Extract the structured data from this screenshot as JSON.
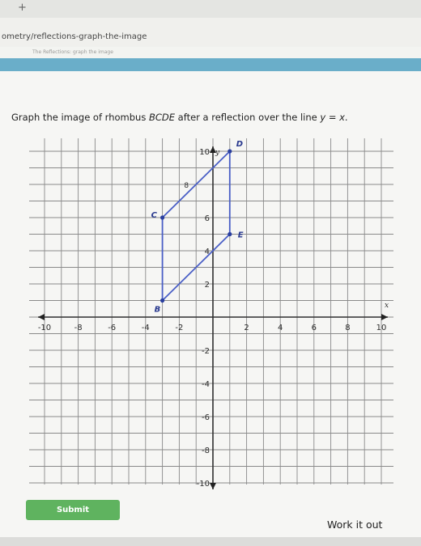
{
  "browser": {
    "plus_label": "+",
    "url": "ometry/reflections-graph-the-image",
    "breadcrumb": "The Reflections: graph the image"
  },
  "question": {
    "prefix": "Graph the image of rhombus ",
    "shape_name": "BCDE",
    "middle": " after a reflection over the line ",
    "equation": "y = x",
    "suffix": "."
  },
  "graph": {
    "x_axis_label": "x",
    "y_axis_label": "y",
    "x_ticks": [
      -10,
      -8,
      -6,
      -4,
      -2,
      2,
      4,
      6,
      8,
      10
    ],
    "y_ticks": [
      10,
      6,
      4,
      2,
      -2,
      -4,
      -6,
      -8,
      -10
    ],
    "minor_tick_labels": [
      {
        "text": "8",
        "x": -2,
        "y": 8
      }
    ],
    "x_range": [
      -10,
      10
    ],
    "y_range": [
      -10,
      10
    ],
    "grid": true,
    "colors": {
      "grid": "#8a8a8a",
      "axis": "#2f2f2f",
      "shape": "#4a5fc6",
      "point": "#2a3f9f",
      "label": "#2b2b2b",
      "arrow": "#222222"
    },
    "rhombus": {
      "name": "BCDE",
      "points": [
        {
          "label": "B",
          "x": -3,
          "y": 1
        },
        {
          "label": "C",
          "x": -3,
          "y": 6
        },
        {
          "label": "D",
          "x": 1,
          "y": 10
        },
        {
          "label": "E",
          "x": 1,
          "y": 5
        }
      ]
    }
  },
  "actions": {
    "submit_label": "Submit",
    "work_label": "Work it out"
  }
}
